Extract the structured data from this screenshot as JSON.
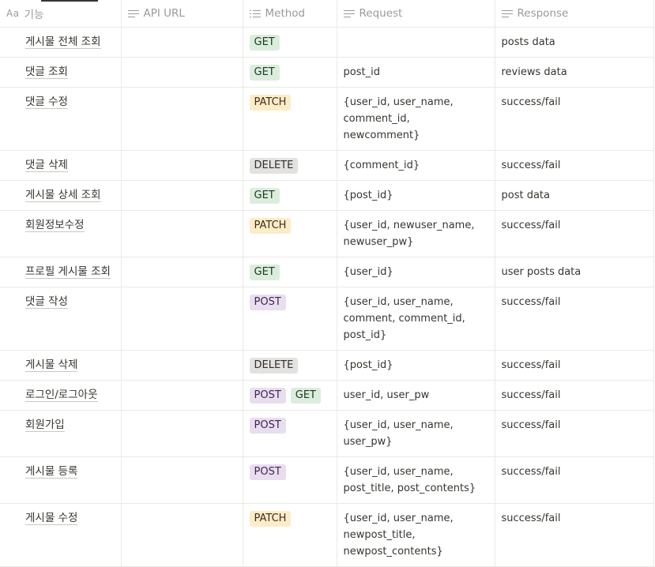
{
  "columns": [
    {
      "icon": "title-icon",
      "icon_text": "Aa",
      "label": "기능"
    },
    {
      "icon": "text-lines-icon",
      "label": "API URL"
    },
    {
      "icon": "multi-select-icon",
      "label": "Method"
    },
    {
      "icon": "text-lines-icon",
      "label": "Request"
    },
    {
      "icon": "text-lines-icon",
      "label": "Response"
    }
  ],
  "tag_colors": {
    "GET": "#dbeddb",
    "PATCH": "#fdecc8",
    "DELETE": "#e3e2e0",
    "POST": "#e8deee"
  },
  "rows": [
    {
      "name": "게시물 전체 조회",
      "url": "",
      "methods": [
        "GET"
      ],
      "request": "",
      "response": "posts data"
    },
    {
      "name": "댓글 조회",
      "url": "",
      "methods": [
        "GET"
      ],
      "request": "post_id",
      "response": "reviews data"
    },
    {
      "name": "댓글 수정",
      "url": "",
      "methods": [
        "PATCH"
      ],
      "request": "{user_id, user_name, comment_id, newcomment}",
      "response": "success/fail"
    },
    {
      "name": "댓글 삭제",
      "url": "",
      "methods": [
        "DELETE"
      ],
      "request": "{comment_id}",
      "response": "success/fail"
    },
    {
      "name": "게시물 상세 조회",
      "url": "",
      "methods": [
        "GET"
      ],
      "request": "{post_id}",
      "response": "post data"
    },
    {
      "name": "회원정보수정",
      "url": "",
      "methods": [
        "PATCH"
      ],
      "request": "{user_id, newuser_name, newuser_pw}",
      "response": "success/fail"
    },
    {
      "name": "프로필 게시물 조회",
      "url": "",
      "methods": [
        "GET"
      ],
      "request": "{user_id}",
      "response": "user posts data"
    },
    {
      "name": "댓글 작성",
      "url": "",
      "methods": [
        "POST"
      ],
      "request": "{user_id, user_name, comment, comment_id, post_id}",
      "response": "success/fail"
    },
    {
      "name": "게시물 삭제",
      "url": "",
      "methods": [
        "DELETE"
      ],
      "request": "{post_id}",
      "response": "success/fail"
    },
    {
      "name": "로그인/로그아웃",
      "url": "",
      "methods": [
        "POST",
        "GET"
      ],
      "request": "user_id, user_pw",
      "response": "success/fail"
    },
    {
      "name": "회원가입",
      "url": "",
      "methods": [
        "POST"
      ],
      "request": "{user_id, user_name, user_pw}",
      "response": "success/fail"
    },
    {
      "name": "게시물 등록",
      "url": "",
      "methods": [
        "POST"
      ],
      "request": "{user_id, user_name, post_title, post_contents}",
      "response": "success/fail"
    },
    {
      "name": "게시물 수정",
      "url": "",
      "methods": [
        "PATCH"
      ],
      "request": "{user_id, user_name, newpost_title, newpost_contents}",
      "response": "success/fail"
    }
  ]
}
